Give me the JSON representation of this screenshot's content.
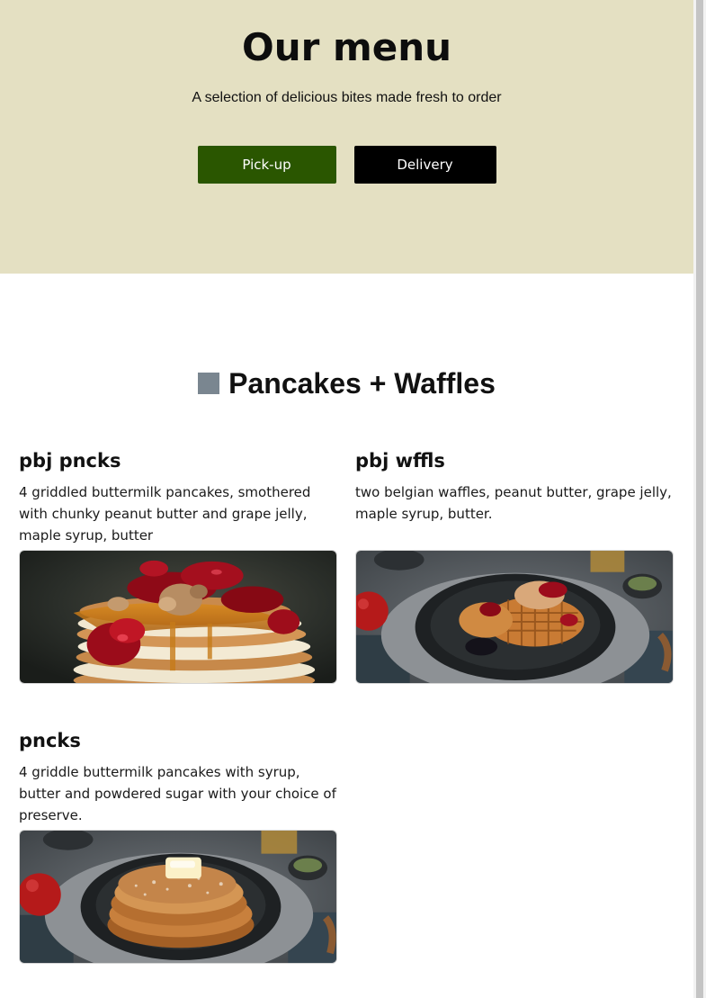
{
  "hero": {
    "title": "Our menu",
    "subtitle": "A selection of delicious bites made fresh to order",
    "pickup_label": "Pick-up",
    "delivery_label": "Delivery"
  },
  "section": {
    "title": "Pancakes + Waffles",
    "icon": "square-icon"
  },
  "items": [
    {
      "name": "pbj pncks",
      "description": "4 griddled buttermilk pancakes, smothered with chunky peanut butter and grape jelly, maple syrup, butter",
      "photo": "pancake-stack-with-jelly-photo"
    },
    {
      "name": "pbj wffls",
      "description": "two belgian waffles, peanut butter, grape jelly, maple syrup, butter.",
      "photo": "waffles-on-plate-photo"
    },
    {
      "name": "pncks",
      "description": "4 griddle buttermilk pancakes with syrup, butter and powdered sugar with your choice of preserve.",
      "photo": "pancakes-on-plate-photo"
    }
  ],
  "colors": {
    "hero_background": "#e4e0c2",
    "pickup_button": "#2a5600",
    "delivery_button": "#000000",
    "section_icon": "#7a8690"
  }
}
